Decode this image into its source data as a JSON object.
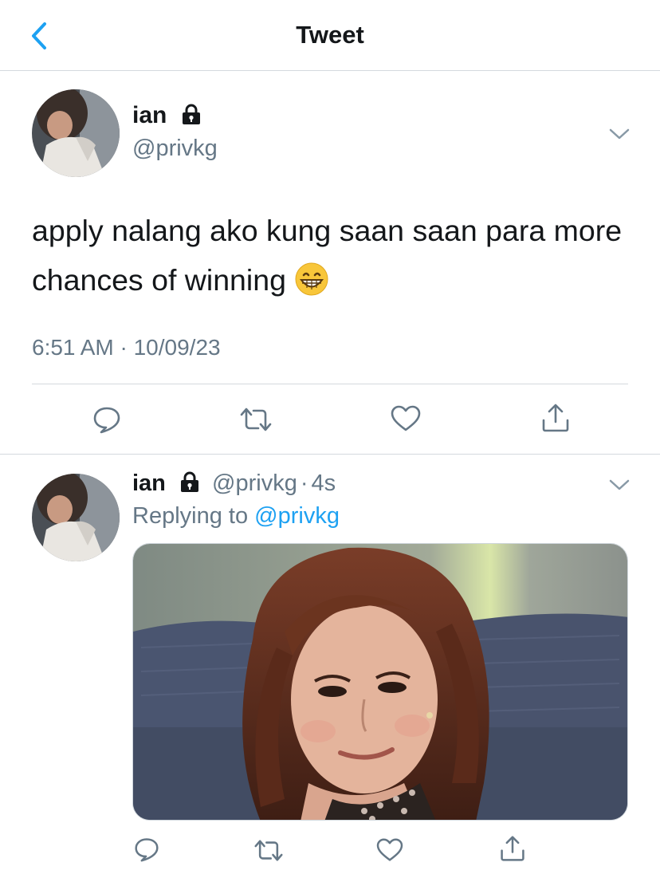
{
  "header": {
    "title": "Tweet",
    "back_icon": "chevron-left-icon"
  },
  "colors": {
    "accent": "#1da1f2",
    "text": "#14171a",
    "muted": "#657786",
    "divider": "#d4d9de"
  },
  "main_tweet": {
    "name": "ian",
    "handle": "@privkg",
    "protected_icon": "lock-icon",
    "text": "apply nalang ako kung saan saan para more chances of winning",
    "emoji": "grinning-face-with-smiling-eyes",
    "timestamp": "6:51 AM · 10/09/23",
    "actions": [
      "reply-icon",
      "retweet-icon",
      "like-icon",
      "share-icon"
    ]
  },
  "reply_tweet": {
    "name": "ian",
    "handle": "@privkg",
    "time_ago": "4s",
    "replying_label": "Replying to",
    "replying_to": "@privkg",
    "media": "photo of woman with auburn hair smirking on a blue couch",
    "actions": [
      "reply-icon",
      "retweet-icon",
      "like-icon",
      "share-icon"
    ]
  }
}
